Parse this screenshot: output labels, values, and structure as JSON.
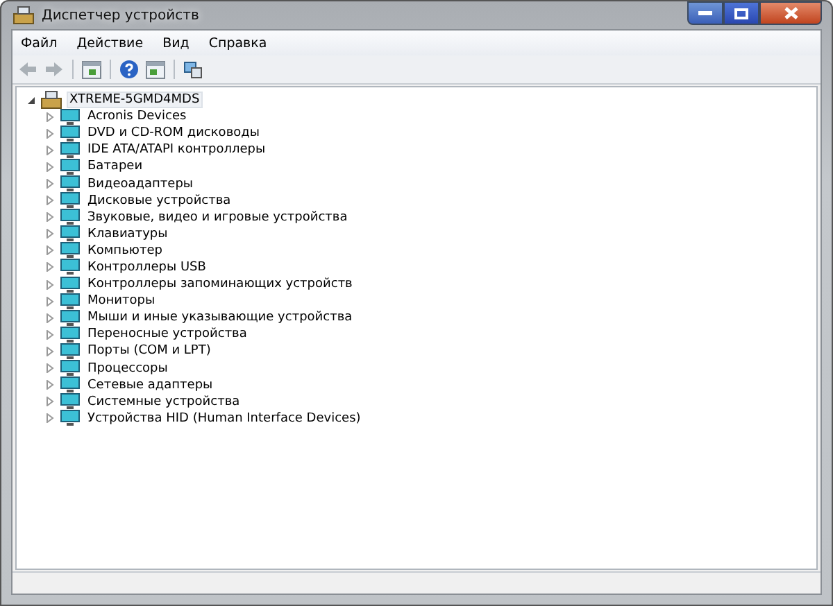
{
  "window": {
    "title": "Диспетчер устройств"
  },
  "menu": [
    "Файл",
    "Действие",
    "Вид",
    "Справка"
  ],
  "tree": {
    "label": "XTREME-5GMD4MDS",
    "expanded": true,
    "selected": true,
    "children": [
      {
        "label": "Acronis Devices",
        "expanded": false,
        "selected": false
      },
      {
        "label": "DVD и CD-ROM дисководы",
        "expanded": false,
        "selected": false
      },
      {
        "label": "IDE ATA/ATAPI контроллеры",
        "expanded": false,
        "selected": false
      },
      {
        "label": "Батареи",
        "expanded": false,
        "selected": false
      },
      {
        "label": "Видеоадаптеры",
        "expanded": false,
        "selected": false
      },
      {
        "label": "Дисковые устройства",
        "expanded": false,
        "selected": false
      },
      {
        "label": "Звуковые, видео и игровые устройства",
        "expanded": false,
        "selected": false
      },
      {
        "label": "Клавиатуры",
        "expanded": false,
        "selected": false
      },
      {
        "label": "Компьютер",
        "expanded": false,
        "selected": false
      },
      {
        "label": "Контроллеры USB",
        "expanded": false,
        "selected": false
      },
      {
        "label": "Контроллеры запоминающих устройств",
        "expanded": false,
        "selected": false
      },
      {
        "label": "Мониторы",
        "expanded": false,
        "selected": false
      },
      {
        "label": "Мыши и иные указывающие устройства",
        "expanded": false,
        "selected": false
      },
      {
        "label": "Переносные устройства",
        "expanded": false,
        "selected": false
      },
      {
        "label": "Порты (COM и LPT)",
        "expanded": false,
        "selected": false
      },
      {
        "label": "Процессоры",
        "expanded": false,
        "selected": false
      },
      {
        "label": "Сетевые адаптеры",
        "expanded": false,
        "selected": false
      },
      {
        "label": "Системные устройства",
        "expanded": false,
        "selected": false
      },
      {
        "label": "Устройства HID (Human Interface Devices)",
        "expanded": false,
        "selected": false
      }
    ]
  }
}
